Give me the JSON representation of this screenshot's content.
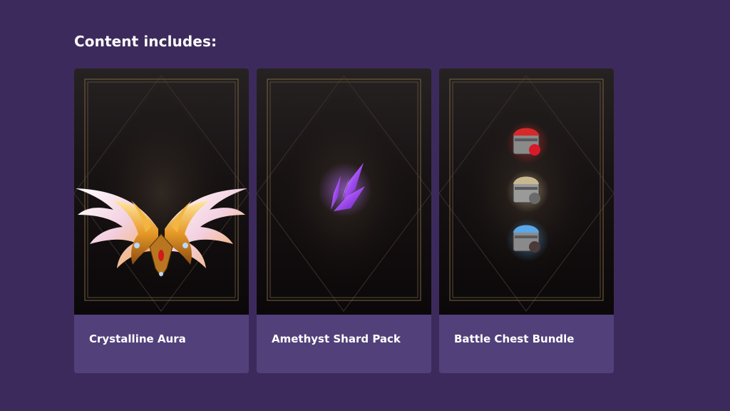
{
  "section": {
    "heading": "Content includes:"
  },
  "items": [
    {
      "label": "Crystalline Aura",
      "icon": "winged-aura-icon"
    },
    {
      "label": "Amethyst Shard Pack",
      "icon": "amethyst-shard-icon"
    },
    {
      "label": "Battle Chest Bundle",
      "icon": "treasure-chests-icon"
    }
  ],
  "colors": {
    "page_background": "#3d2a5c",
    "label_bar": "#52407a",
    "frame_gold": "#7a6344"
  }
}
